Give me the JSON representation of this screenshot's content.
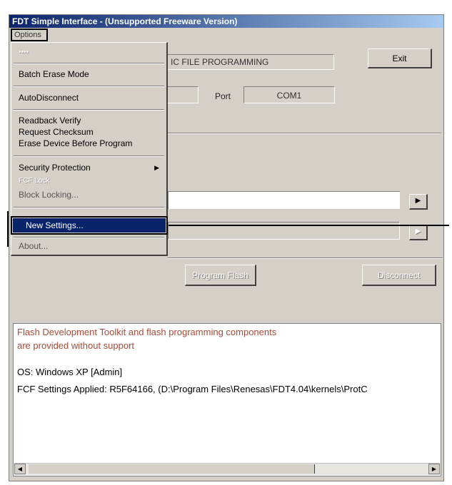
{
  "window": {
    "title": "FDT Simple Interface - (Unsupported Freeware Version)"
  },
  "menubar": {
    "options_label": "Options"
  },
  "main": {
    "mode_text": "IC FILE PROGRAMMING",
    "exit_label": "Exit",
    "port_label": "Port",
    "port_value": "COM1",
    "browse_arrow": "▶",
    "program_label": "Program Flash",
    "disconnect_label": "Disconnect"
  },
  "options_menu": {
    "items": [
      "Batch Erase Mode",
      "AutoDisconnect",
      "Readback Verify",
      "Request Checksum",
      "Erase Device Before Program",
      "Security Protection",
      "Block Locking...",
      "New Settings...",
      "About..."
    ],
    "disabled_item": "FCF Lock"
  },
  "log": {
    "line1": "Flash Development Toolkit and flash programming components",
    "line2": "are provided without support",
    "line3": "OS: Windows XP [Admin]",
    "line4": "FCF Settings Applied: R5F64166, (D:\\Program Files\\Renesas\\FDT4.04\\kernels\\ProtC"
  }
}
